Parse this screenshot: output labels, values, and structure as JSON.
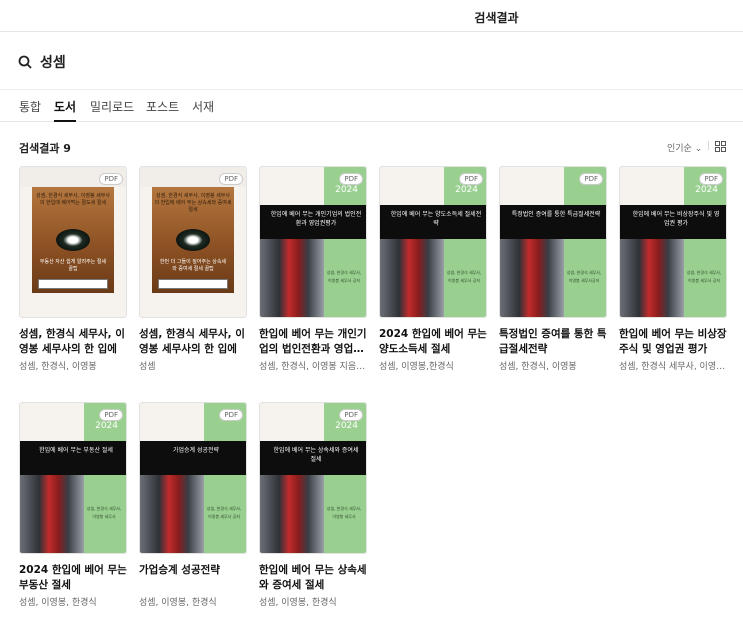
{
  "header": {
    "title": "검색결과"
  },
  "search": {
    "query": "성셈"
  },
  "tabs": [
    {
      "label": "통합"
    },
    {
      "label": "도서"
    },
    {
      "label": "밀리로드"
    },
    {
      "label": "포스트"
    },
    {
      "label": "서재"
    }
  ],
  "results": {
    "count_label": "검색결과 9",
    "sort_label": "인기순",
    "sep": "|"
  },
  "pdf_badge": "PDF",
  "books": [
    {
      "title": "성셈, 한경식 세무사, 이영봉 세무사의 한 입에 …",
      "author": "성셈, 한경식, 이영봉",
      "cover": "wood",
      "cover_text": "성셈, 한경식 세무사, 이영봉 세무사의 한입에 베어먹는 절도세 절세",
      "cover_sub": "부동산 자산 쉽게 알려주는 절세 꿀팁"
    },
    {
      "title": "성셈, 한경식 세무사, 이영봉 세무사의 한 입에 …",
      "author": "성셈",
      "cover": "wood",
      "cover_text": "성셈, 한경식 세무사, 이영봉 세무사의 한입에 베어 무는 상속세와 증여세 절세",
      "cover_sub": "한번 더 그들이 짚어주는 상속세와 증여세 절세 꿀팁"
    },
    {
      "title": "한입에 베어 무는 개인기업의 법인전환과 영업…",
      "author": "성셈, 한경식, 이영봉 지음/ …",
      "cover": "green",
      "year": "2024",
      "cover_text": "한입에 베어 무는 개인기업의 법인전환과 영업권평가",
      "cover_info": "성셈, 한경식 세무사, 이영봉 세무사 공저"
    },
    {
      "title": "2024 한입에 베어 무는 양도소득세 절세",
      "author": "성셈, 이영봉,한경식",
      "cover": "green",
      "year": "2024",
      "cover_text": "한입에 베어 무는 양도소득세 절세전략",
      "cover_info": "성셈, 한경식 세무사, 이영봉 세무사 공저"
    },
    {
      "title": "특정법인 증여를 통한 특급절세전략",
      "author": "성셈, 한경식, 이영봉",
      "cover": "green",
      "year": "",
      "cover_text": "특정법인 증여를 통한 특급절세전략",
      "cover_info": "성셈, 한경식 세무사, 이영봉 세무사공저"
    },
    {
      "title": "한입에 베어 무는 비상장주식 및 영업권 평가",
      "author": "성셈, 한경식 세무사, 이영…",
      "cover": "green",
      "year": "2024",
      "cover_text": "한입에 베어 무는 비상장주식 및 영업권 평가",
      "cover_info": "성셈, 한경식 세무사, 이영봉 세무사 공저"
    },
    {
      "title": "2024 한입에 베어 무는 부동산 절세",
      "author": "성셈, 이영봉, 한경식",
      "cover": "green",
      "year": "2024",
      "cover_text": "한입에 베어 무는 부동산 절세",
      "cover_info": "성셈, 한경식 세무사, 이영봉 세무사"
    },
    {
      "title": "가업승계 성공전략",
      "author": "성셈, 이영봉, 한경식",
      "cover": "green",
      "year": "",
      "cover_text": "가업승계 성공전략",
      "cover_info": "성셈, 한경식 세무사, 이영봉 세무사 공저"
    },
    {
      "title": "한입에 베어 무는 상속세와 증여세 절세",
      "author": "성셈, 이영봉, 한경식",
      "cover": "green",
      "year": "2024",
      "cover_text": "한입에 베어 무는 상속세와 증여세 절세",
      "cover_info": "성셈, 한경식 세무사, 이영봉 세무사"
    }
  ]
}
